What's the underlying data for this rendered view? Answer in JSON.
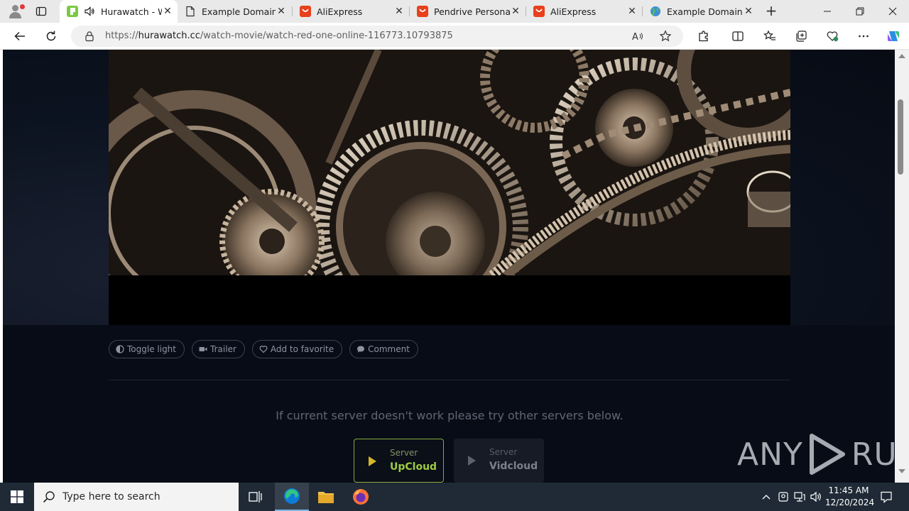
{
  "browser": {
    "tabs": [
      {
        "title": "Hurawatch - Watch",
        "active": true,
        "icon": "hurawatch-icon",
        "audio": true
      },
      {
        "title": "Example Domain",
        "active": false,
        "icon": "page-icon"
      },
      {
        "title": "AliExpress",
        "active": false,
        "icon": "aliexpress-icon"
      },
      {
        "title": "Pendrive Personaliz",
        "active": false,
        "icon": "aliexpress-icon"
      },
      {
        "title": "AliExpress",
        "active": false,
        "icon": "aliexpress-icon"
      },
      {
        "title": "Example Domains",
        "active": false,
        "icon": "globe-icon"
      }
    ],
    "address": {
      "prefix": "https://",
      "host": "hurawatch.cc",
      "path": "/watch-movie/watch-red-one-online-116773.10793875"
    },
    "accent": "#0078d4"
  },
  "page": {
    "actions": [
      {
        "label": "Toggle light",
        "icon": "half-moon-icon"
      },
      {
        "label": "Trailer",
        "icon": "video-camera-icon"
      },
      {
        "label": "Add to favorite",
        "icon": "heart-icon"
      },
      {
        "label": "Comment",
        "icon": "chat-bubble-icon"
      }
    ],
    "server_notice": "If current server doesn't work please try other servers below.",
    "servers": [
      {
        "label": "Server",
        "name": "UpCloud",
        "active": true
      },
      {
        "label": "Server",
        "name": "Vidcloud",
        "active": false
      }
    ],
    "accent_green": "#9ecb40",
    "play_yellow": "#d9b827"
  },
  "watermark": {
    "text_left": "ANY",
    "text_right": "RUN"
  },
  "taskbar": {
    "search_placeholder": "Type here to search",
    "time": "11:45 AM",
    "date": "12/20/2024"
  }
}
